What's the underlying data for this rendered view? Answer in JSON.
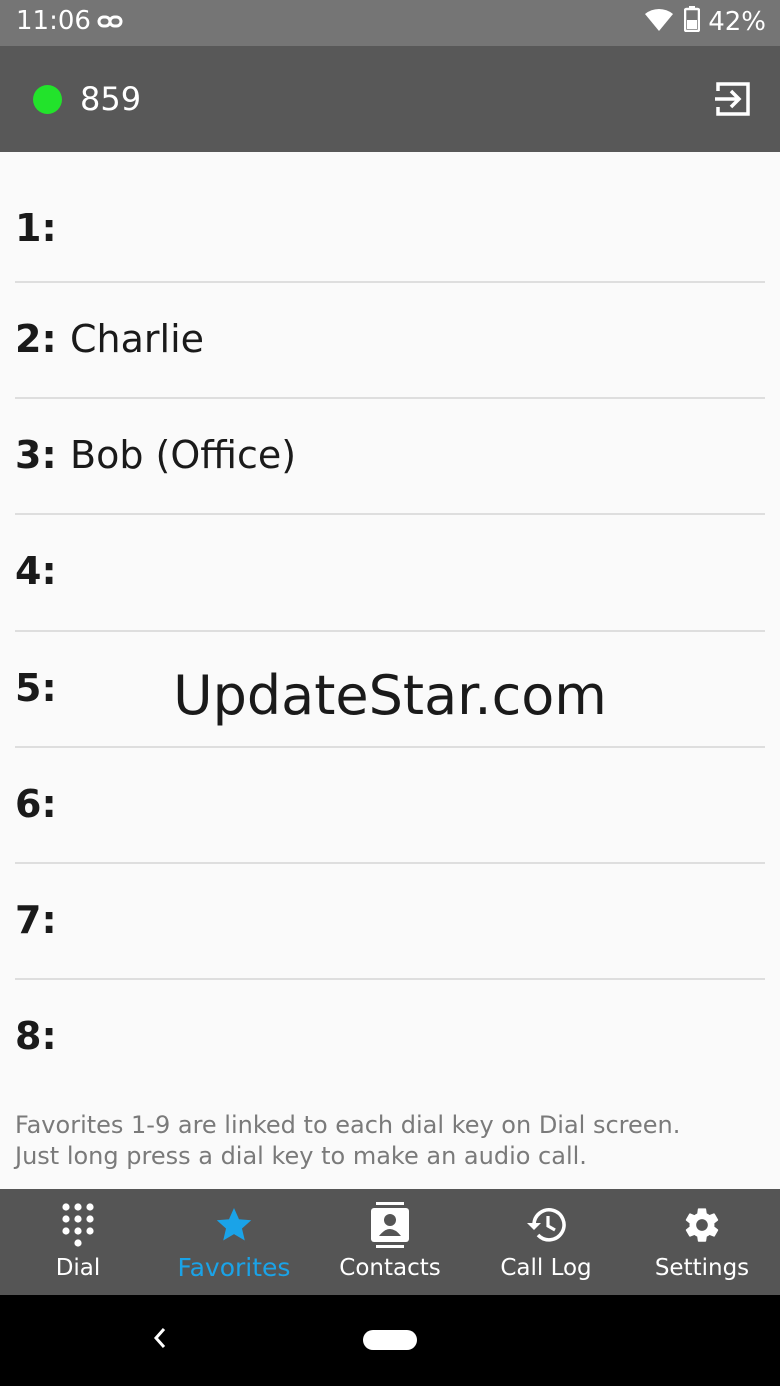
{
  "status_bar": {
    "time": "11:06",
    "battery": "42%",
    "icons": [
      "link-icon",
      "wifi-icon",
      "battery-icon"
    ]
  },
  "app_bar": {
    "extension": "859",
    "status_color": "#22e32b",
    "logout_icon": "logout-icon"
  },
  "favorites": [
    {
      "num": "1:",
      "name": ""
    },
    {
      "num": "2:",
      "name": "Charlie"
    },
    {
      "num": "3:",
      "name": "Bob (Office)"
    },
    {
      "num": "4:",
      "name": ""
    },
    {
      "num": "5:",
      "name": ""
    },
    {
      "num": "6:",
      "name": ""
    },
    {
      "num": "7:",
      "name": ""
    },
    {
      "num": "8:",
      "name": ""
    }
  ],
  "watermark": "UpdateStar.com",
  "hint": {
    "line1": "Favorites 1-9 are linked to each dial key on Dial screen.",
    "line2": "Just long press a dial key to make an audio call."
  },
  "bottom_nav": {
    "active_color": "#1aa3e8",
    "items": [
      {
        "label": "Dial",
        "icon": "dialpad-icon"
      },
      {
        "label": "Favorites",
        "icon": "star-icon",
        "active": true
      },
      {
        "label": "Contacts",
        "icon": "contacts-icon"
      },
      {
        "label": "Call Log",
        "icon": "history-icon"
      },
      {
        "label": "Settings",
        "icon": "gear-icon"
      }
    ]
  }
}
